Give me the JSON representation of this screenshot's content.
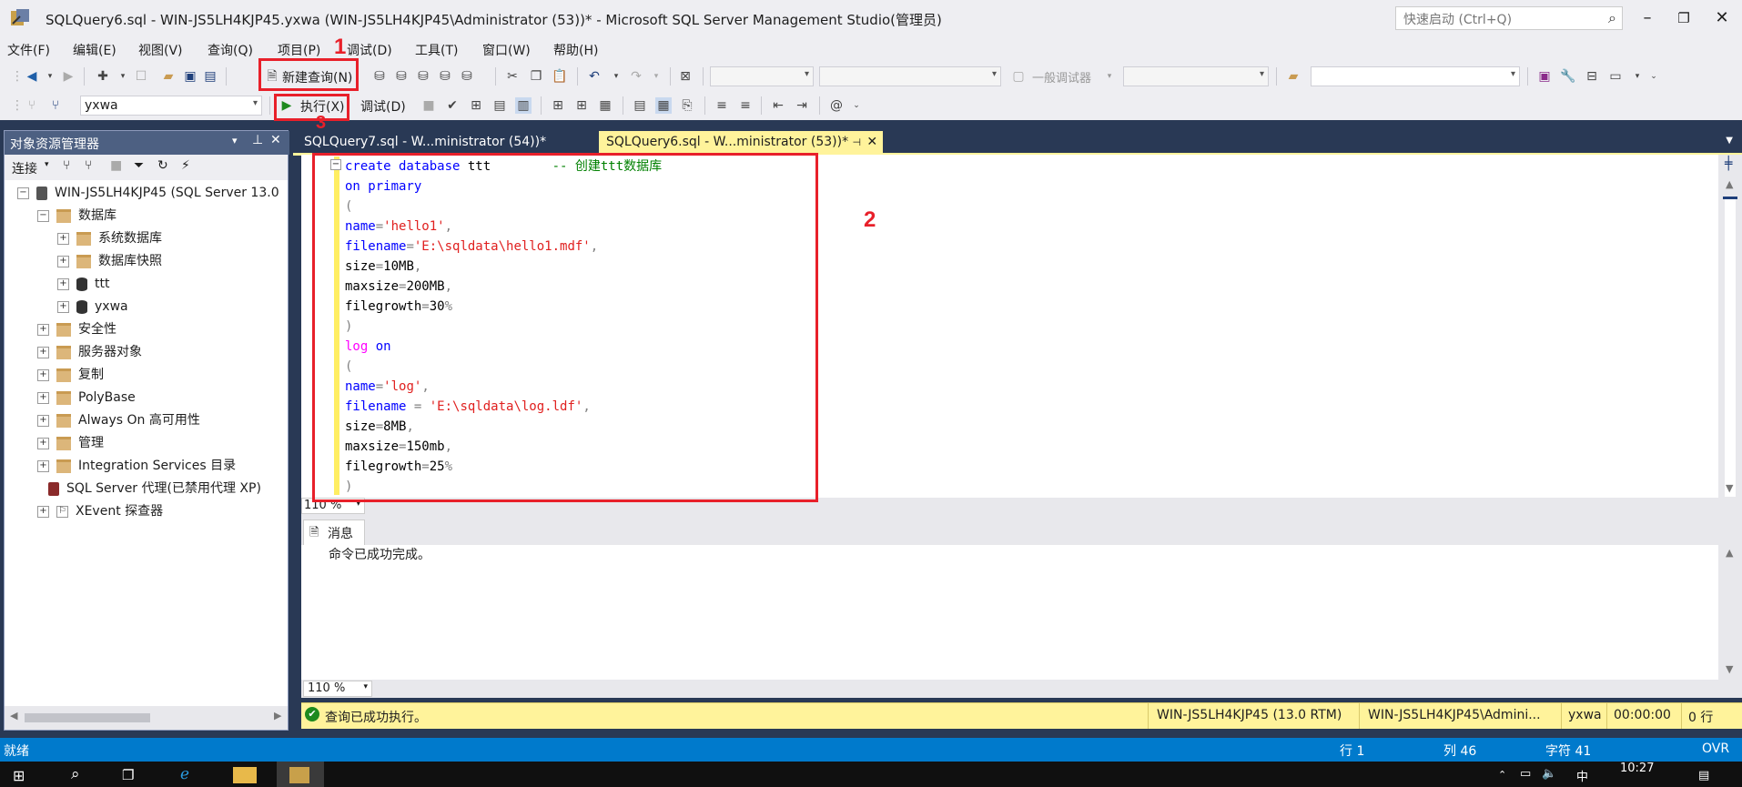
{
  "window": {
    "title": "SQLQuery6.sql - WIN-JS5LH4KJP45.yxwa (WIN-JS5LH4KJP45\\Administrator (53))* - Microsoft SQL Server Management Studio(管理员)",
    "quick_launch_placeholder": "快速启动 (Ctrl+Q)"
  },
  "menu": [
    "文件(F)",
    "编辑(E)",
    "视图(V)",
    "查询(Q)",
    "项目(P)",
    "调试(D)",
    "工具(T)",
    "窗口(W)",
    "帮助(H)"
  ],
  "toolbar1": {
    "new_query": "新建查询(N)",
    "debugger_label": "一般调试器"
  },
  "toolbar2": {
    "database": "yxwa",
    "execute": "执行(X)",
    "debug": "调试(D)"
  },
  "annotations": {
    "box1": "1",
    "box2": "2",
    "box3": "3"
  },
  "object_explorer": {
    "title": "对象资源管理器",
    "connect": "连接",
    "tree": [
      {
        "label": "WIN-JS5LH4KJP45 (SQL Server 13.0",
        "exp": "⊟",
        "icon": "server"
      },
      {
        "label": "数据库",
        "exp": "⊟",
        "icon": "folder"
      },
      {
        "label": "系统数据库",
        "exp": "⊞",
        "icon": "folder"
      },
      {
        "label": "数据库快照",
        "exp": "⊞",
        "icon": "folder"
      },
      {
        "label": "ttt",
        "exp": "⊞",
        "icon": "db"
      },
      {
        "label": "yxwa",
        "exp": "⊞",
        "icon": "db"
      },
      {
        "label": "安全性",
        "exp": "⊞",
        "icon": "folder"
      },
      {
        "label": "服务器对象",
        "exp": "⊞",
        "icon": "folder"
      },
      {
        "label": "复制",
        "exp": "⊞",
        "icon": "folder"
      },
      {
        "label": "PolyBase",
        "exp": "⊞",
        "icon": "folder"
      },
      {
        "label": "Always On 高可用性",
        "exp": "⊞",
        "icon": "folder"
      },
      {
        "label": "管理",
        "exp": "⊞",
        "icon": "folder"
      },
      {
        "label": "Integration Services 目录",
        "exp": "⊞",
        "icon": "folder"
      },
      {
        "label": "SQL Server 代理(已禁用代理 XP)",
        "exp": "",
        "icon": "agent"
      },
      {
        "label": "XEvent 探查器",
        "exp": "⊞",
        "icon": "xevent"
      }
    ]
  },
  "tabs": [
    {
      "label": "SQLQuery7.sql - W...ministrator (54))*",
      "active": false
    },
    {
      "label": "SQLQuery6.sql - W...ministrator (53))*",
      "active": true
    }
  ],
  "code": [
    [
      [
        "kw",
        "create database "
      ],
      [
        "bk",
        "ttt"
      ],
      [
        "bk",
        "        "
      ],
      [
        "cm",
        "-- 创建ttt数据库"
      ]
    ],
    [
      [
        "kw",
        "on primary"
      ]
    ],
    [
      [
        "gr",
        "("
      ]
    ],
    [
      [
        "kw",
        "name"
      ],
      [
        "gr",
        "="
      ],
      [
        "str",
        "'hello1'"
      ],
      [
        "gr",
        ","
      ]
    ],
    [
      [
        "kw",
        "filename"
      ],
      [
        "gr",
        "="
      ],
      [
        "str",
        "'E:\\sqldata\\hello1.mdf'"
      ],
      [
        "gr",
        ","
      ]
    ],
    [
      [
        "bk",
        "size"
      ],
      [
        "gr",
        "="
      ],
      [
        "bk",
        "10MB"
      ],
      [
        "gr",
        ","
      ]
    ],
    [
      [
        "bk",
        "maxsize"
      ],
      [
        "gr",
        "="
      ],
      [
        "bk",
        "200MB"
      ],
      [
        "gr",
        ","
      ]
    ],
    [
      [
        "bk",
        "filegrowth"
      ],
      [
        "gr",
        "="
      ],
      [
        "bk",
        "30"
      ],
      [
        "gr",
        "%"
      ]
    ],
    [
      [
        "gr",
        ")"
      ]
    ],
    [
      [
        "pk",
        "log"
      ],
      [
        "bk",
        " "
      ],
      [
        "kw",
        "on"
      ]
    ],
    [
      [
        "gr",
        "("
      ]
    ],
    [
      [
        "kw",
        "name"
      ],
      [
        "gr",
        "="
      ],
      [
        "str",
        "'log'"
      ],
      [
        "gr",
        ","
      ]
    ],
    [
      [
        "kw",
        "filename"
      ],
      [
        "gr",
        " = "
      ],
      [
        "str",
        "'E:\\sqldata\\log.ldf'"
      ],
      [
        "gr",
        ","
      ]
    ],
    [
      [
        "bk",
        "size"
      ],
      [
        "gr",
        "="
      ],
      [
        "bk",
        "8MB"
      ],
      [
        "gr",
        ","
      ]
    ],
    [
      [
        "bk",
        "maxsize"
      ],
      [
        "gr",
        "="
      ],
      [
        "bk",
        "150mb"
      ],
      [
        "gr",
        ","
      ]
    ],
    [
      [
        "bk",
        "filegrowth"
      ],
      [
        "gr",
        "="
      ],
      [
        "bk",
        "25"
      ],
      [
        "gr",
        "%"
      ]
    ],
    [
      [
        "gr",
        ")"
      ]
    ]
  ],
  "editor_zoom": "110 %",
  "messages": {
    "tab": "消息",
    "text": "命令已成功完成。",
    "zoom": "110 %"
  },
  "query_status": {
    "message": "查询已成功执行。",
    "server": "WIN-JS5LH4KJP45 (13.0 RTM)",
    "user": "WIN-JS5LH4KJP45\\Admini...",
    "database": "yxwa",
    "elapsed": "00:00:00",
    "rows": "0 行"
  },
  "statusbar": {
    "ready": "就绪",
    "line": "行 1",
    "col": "列 46",
    "ch": "字符 41",
    "mode": "OVR"
  },
  "taskbar": {
    "time": "10:27",
    "ime": "中"
  },
  "colors": {
    "accent": "#007acc",
    "annotation": "#e8202a",
    "query_status_bg": "#fff39b"
  }
}
